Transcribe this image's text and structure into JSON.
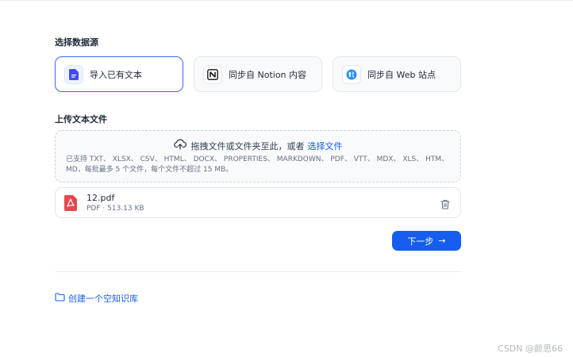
{
  "datasource": {
    "title": "选择数据源",
    "options": [
      {
        "label": "导入已有文本",
        "icon": "document-icon",
        "selected": true
      },
      {
        "label": "同步自 Notion 内容",
        "icon": "notion-icon",
        "selected": false
      },
      {
        "label": "同步自 Web 站点",
        "icon": "web-icon",
        "selected": false
      }
    ]
  },
  "upload": {
    "title": "上传文本文件",
    "drag_text": "拖拽文件或文件夹至此，或者",
    "select_link": "选择文件",
    "hint": "已支持 TXT、 XLSX、 CSV、 HTML、 DOCX、 PROPERTIES、 MARKDOWN、 PDF、 VTT、 MDX、 XLS、 HTM、 MD，每批最多 5 个文件，每个文件不超过 15 MB。"
  },
  "files": [
    {
      "name": "12.pdf",
      "meta": "PDF · 513.13 KB"
    }
  ],
  "actions": {
    "next_label": "下一步",
    "create_empty_label": "创建一个空知识库"
  },
  "watermark": "CSDN @颜思66",
  "colors": {
    "accent": "#155eef",
    "pdf_red": "#e5484d"
  }
}
